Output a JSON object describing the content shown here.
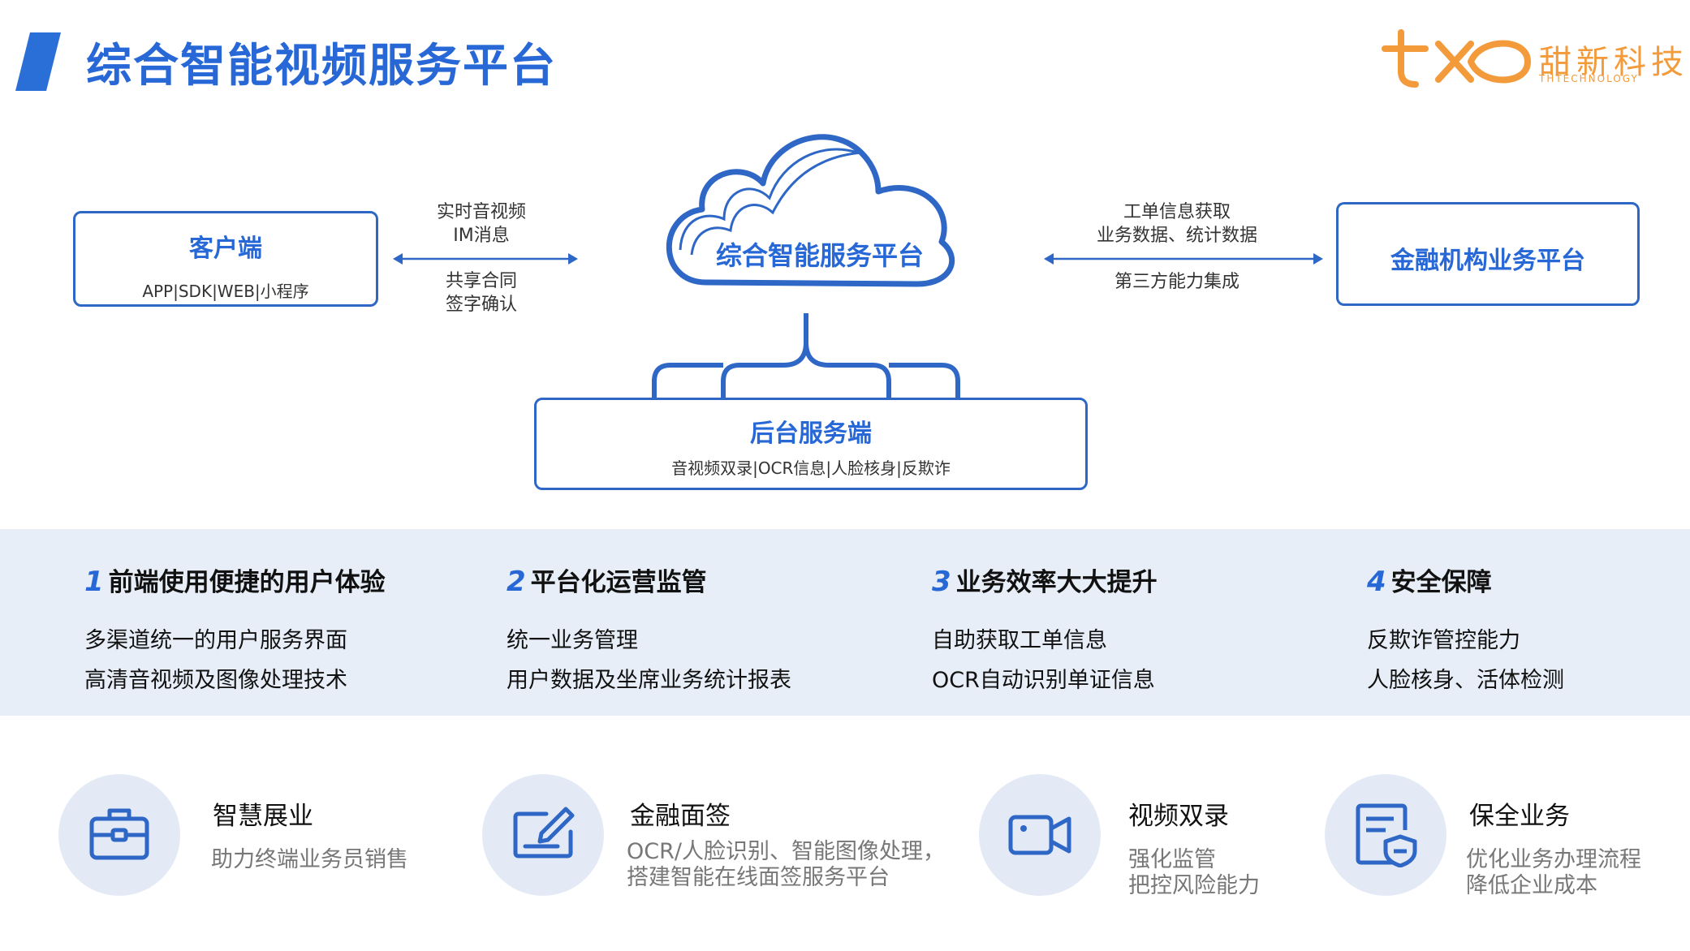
{
  "header": {
    "title": "综合智能视频服务平台"
  },
  "logo": {
    "name": "甜新科技",
    "sub": "THTECHNOLOGY",
    "brand_color": "#f39a3a"
  },
  "accent_color": "#2768d6",
  "diagram": {
    "client": {
      "title": "客户端",
      "subtitle": "APP|SDK|WEB|小程序"
    },
    "left_link": {
      "top_line1": "实时音视频",
      "top_line2": "IM消息",
      "bottom_line1": "共享合同",
      "bottom_line2": "签字确认"
    },
    "cloud": {
      "label": "综合智能服务平台"
    },
    "right_link": {
      "top_line1": "工单信息获取",
      "top_line2": "业务数据、统计数据",
      "bottom_line1": "第三方能力集成"
    },
    "finance": {
      "title": "金融机构业务平台"
    },
    "backend": {
      "title": "后台服务端",
      "subtitle": "音视频双录|OCR信息|人脸核身|反欺诈"
    }
  },
  "features": [
    {
      "num": "1",
      "title": "前端使用便捷的用户体验",
      "lines": [
        "多渠道统一的用户服务界面",
        "高清音视频及图像处理技术"
      ]
    },
    {
      "num": "2",
      "title": "平台化运营监管",
      "lines": [
        "统一业务管理",
        "用户数据及坐席业务统计报表"
      ]
    },
    {
      "num": "3",
      "title": "业务效率大大提升",
      "lines": [
        "自助获取工单信息",
        "OCR自动识别单证信息"
      ]
    },
    {
      "num": "4",
      "title": "安全保障",
      "lines": [
        "反欺诈管控能力",
        "人脸核身、活体检测"
      ]
    }
  ],
  "apps": [
    {
      "icon": "briefcase-icon",
      "title": "智慧展业",
      "desc": [
        "助力终端业务员销售"
      ]
    },
    {
      "icon": "signature-pad-icon",
      "title": "金融面签",
      "desc": [
        "OCR/人脸识别、智能图像处理，",
        "搭建智能在线面签服务平台"
      ]
    },
    {
      "icon": "video-camera-icon",
      "title": "视频双录",
      "desc": [
        "强化监管",
        "把控风险能力"
      ]
    },
    {
      "icon": "shield-document-icon",
      "title": "保全业务",
      "desc": [
        "优化业务办理流程",
        "降低企业成本"
      ]
    }
  ]
}
